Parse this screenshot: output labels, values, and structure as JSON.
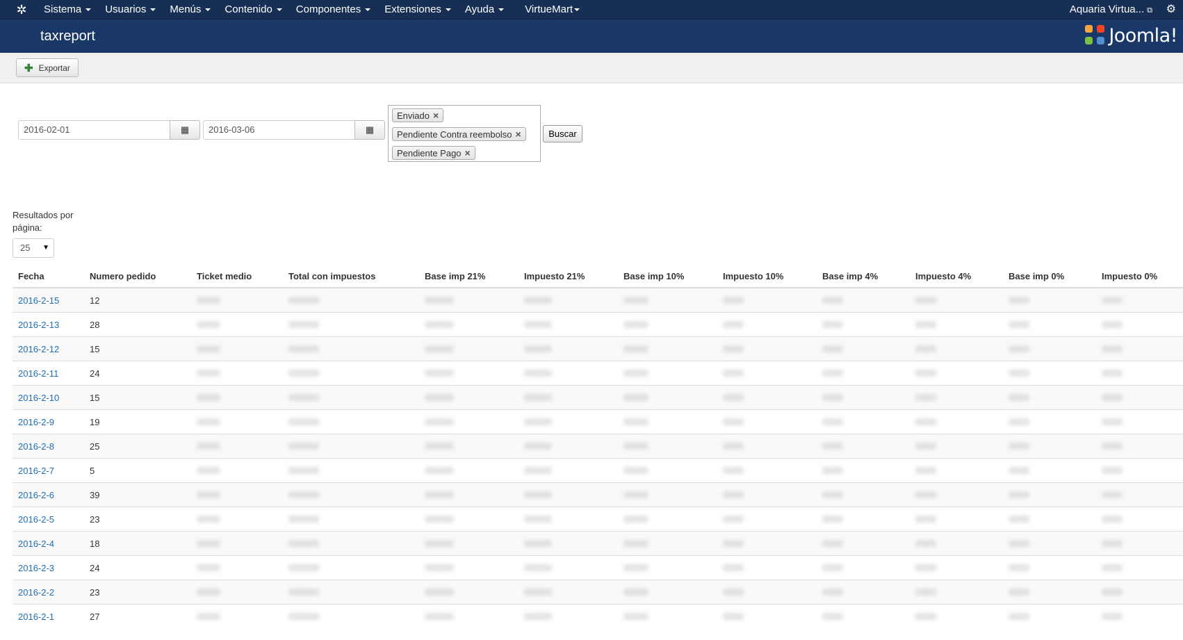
{
  "navbar": {
    "menu": [
      "Sistema",
      "Usuarios",
      "Menús",
      "Contenido",
      "Componentes",
      "Extensiones",
      "Ayuda",
      "VirtueMart"
    ],
    "site_name": "Aquaria Virtua..."
  },
  "header": {
    "title": "taxreport",
    "brand": "Joomla!"
  },
  "toolbar": {
    "export_label": "Exportar"
  },
  "filters": {
    "date_from": "2016-02-01",
    "date_to": "2016-03-06",
    "statuses": [
      "Enviado",
      "Pendiente Contra reembolso",
      "Pendiente Pago"
    ],
    "search_label": "Buscar"
  },
  "pagination": {
    "label": "Resultados por página:",
    "value": "25"
  },
  "table": {
    "columns": [
      "Fecha",
      "Numero pedido",
      "Ticket medio",
      "Total con impuestos",
      "Base imp 21%",
      "Impuesto 21%",
      "Base imp 10%",
      "Impuesto 10%",
      "Base imp 4%",
      "Impuesto 4%",
      "Base imp 0%",
      "Impuesto 0%"
    ],
    "rows": [
      {
        "fecha": "2016-2-15",
        "pedidos": "12"
      },
      {
        "fecha": "2016-2-13",
        "pedidos": "28"
      },
      {
        "fecha": "2016-2-12",
        "pedidos": "15"
      },
      {
        "fecha": "2016-2-11",
        "pedidos": "24"
      },
      {
        "fecha": "2016-2-10",
        "pedidos": "15"
      },
      {
        "fecha": "2016-2-9",
        "pedidos": "19"
      },
      {
        "fecha": "2016-2-8",
        "pedidos": "25"
      },
      {
        "fecha": "2016-2-7",
        "pedidos": "5"
      },
      {
        "fecha": "2016-2-6",
        "pedidos": "39"
      },
      {
        "fecha": "2016-2-5",
        "pedidos": "23"
      },
      {
        "fecha": "2016-2-4",
        "pedidos": "18"
      },
      {
        "fecha": "2016-2-3",
        "pedidos": "24"
      },
      {
        "fecha": "2016-2-2",
        "pedidos": "23"
      },
      {
        "fecha": "2016-2-1",
        "pedidos": "27"
      }
    ]
  },
  "colors": {
    "navbar": "#172f55",
    "header": "#1a3867",
    "link": "#1f6fb2"
  }
}
